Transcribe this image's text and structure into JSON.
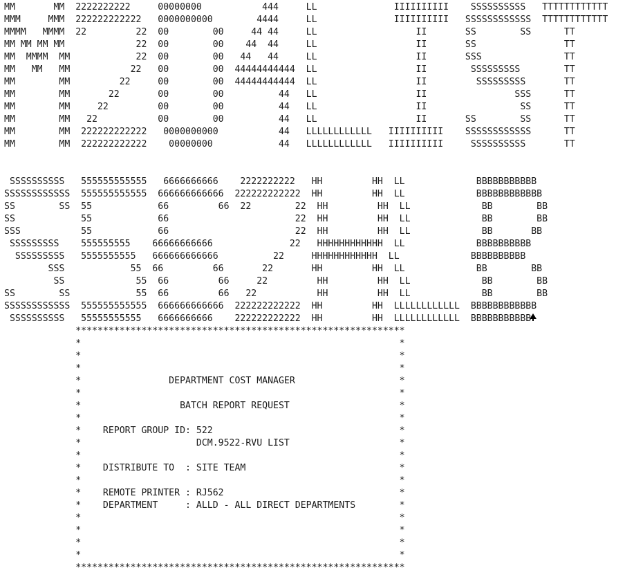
{
  "banner_1": {
    "lines": [
      "MM       MM  2222222222     00000000           444     LL              IIIIIIIIII    SSSSSSSSSS   TTTTTTTTTTTT",
      "MMM     MMM  222222222222   0000000000        4444     LL              IIIIIIIIII   SSSSSSSSSSSS  TTTTTTTTTTTT",
      "MMMM   MMMM  22         22  00        00     44 44     LL                  II       SS        SS      TT",
      "MM MM MM MM             22  00        00    44  44     LL                  II       SS                TT",
      "MM  MMMM  MM            22  00        00   44   44     LL                  II       SSS               TT",
      "MM   MM   MM           22   00        00  44444444444  LL                  II        SSSSSSSSS        TT",
      "MM        MM         22     00        00  44444444444  LL                  II         SSSSSSSSS       TT",
      "MM        MM       22       00        00          44   LL                  II                SSS      TT",
      "MM        MM     22         00        00          44   LL                  II                 SS      TT",
      "MM        MM   22           00        00          44   LL                  II       SS        SS      TT",
      "MM        MM  222222222222   0000000000           44   LLLLLLLLLLLL   IIIIIIIIII    SSSSSSSSSSSS      TT",
      "MM        MM  222222222222    00000000            44   LLLLLLLLLLLL   IIIIIIIIII     SSSSSSSSSS       TT"
    ]
  },
  "banner_2": {
    "lines": [
      " SSSSSSSSSS   555555555555   6666666666    2222222222   HH         HH  LL             BBBBBBBBBBB",
      "SSSSSSSSSSSS  555555555555  666666666666  222222222222  HH         HH  LL             BBBBBBBBBBBB",
      "SS        SS  55            66         66  22        22  HH         HH  LL             BB        BB",
      "SS            55            66                       22  HH         HH  LL             BB        BB",
      "SSS           55            66                       22  HH         HH  LL             BB       BB",
      " SSSSSSSSS    555555555    66666666666              22   HHHHHHHHHHHH  LL             BBBBBBBBBB",
      "  SSSSSSSSS   5555555555   666666666666          22     HHHHHHHHHHHH  LL             BBBBBBBBBB",
      "        SSS            55  66         66       22       HH         HH  LL             BB        BB",
      "         SS             55  66         66     22         HH         HH  LL             BB        BB",
      "SS        SS            55  66         66   22           HH         HH  LL             BB        BB",
      "SSSSSSSSSSSS  555555555555  666666666666  222222222222  HH         HH  LLLLLLLLLLLL  BBBBBBBBBBBB",
      " SSSSSSSSSS   55555555555   6666666666    222222222222  HH         HH  LLLLLLLLLLLL  BBBBBBBBBBB"
    ]
  },
  "report_box": {
    "border_line": "             ************************************************************",
    "blank_line": "             *                                                          *",
    "title_line": "             *                DEPARTMENT COST MANAGER                   *",
    "subtitle_line": "             *                  BATCH REPORT REQUEST                    *",
    "report_group_line": "             *    REPORT GROUP ID: 522                                  *",
    "report_name_line": "             *                     DCM.9522-RVU LIST                    *",
    "distribute_line": "             *    DISTRIBUTE TO  : SITE TEAM                            *",
    "printer_line": "             *    REMOTE PRINTER : RJ562                                *",
    "department_line": "             *    DEPARTMENT     : ALLD - ALL DIRECT DEPARTMENTS        *"
  },
  "cursor": {
    "icon": "mouse-pointer-icon"
  }
}
